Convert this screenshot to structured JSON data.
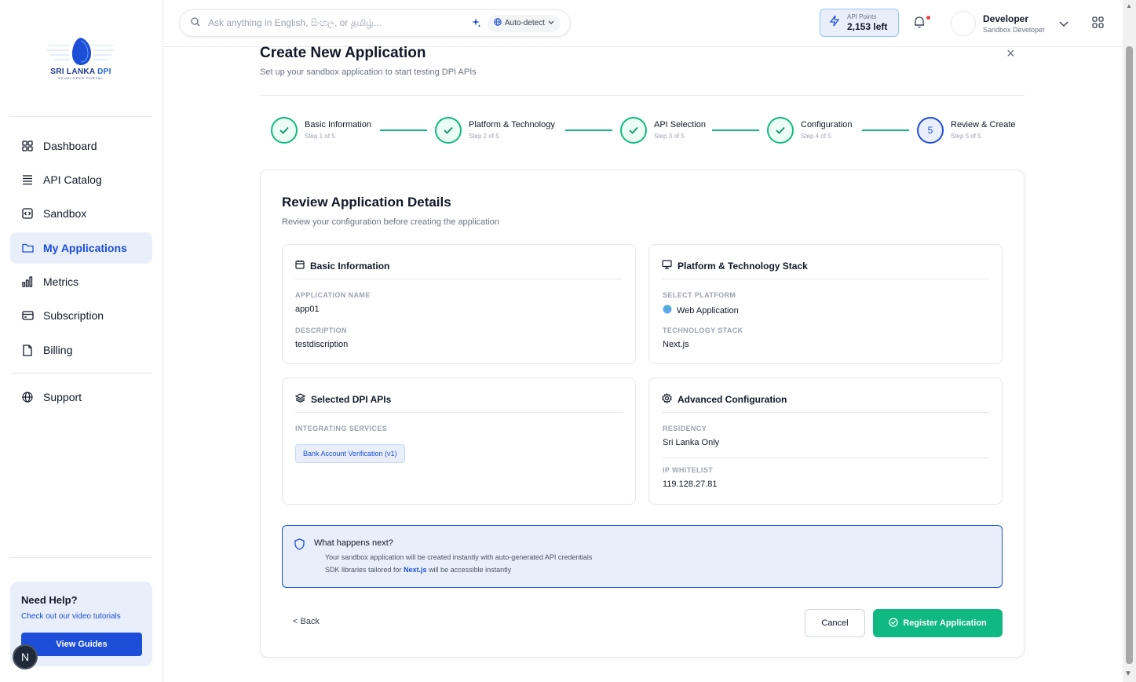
{
  "sidebar": {
    "logo": {
      "text_main": "SRI LANKA ",
      "text_accent": "DPI",
      "text_sub": "DEVELOPER PORTAL"
    },
    "items": [
      {
        "label": "Dashboard",
        "icon": "dashboard-grid-icon"
      },
      {
        "label": "API Catalog",
        "icon": "list-icon"
      },
      {
        "label": "Sandbox",
        "icon": "code-box-icon"
      },
      {
        "label": "My Applications",
        "icon": "folder-icon",
        "active": true
      },
      {
        "label": "Metrics",
        "icon": "bar-chart-icon"
      },
      {
        "label": "Subscription",
        "icon": "credit-card-icon"
      },
      {
        "label": "Billing",
        "icon": "file-icon"
      },
      {
        "label": "Support",
        "icon": "globe-icon"
      }
    ],
    "help": {
      "title": "Need Help?",
      "subtitle": "Check out our video tutorials",
      "button": "View Guides"
    },
    "badge": "N"
  },
  "topbar": {
    "search_placeholder": "Ask anything in English, සිංහල, or தமிழ்...",
    "language": "Auto-detect",
    "points_label": "API Points",
    "points_value": "2,153 left",
    "user_name": "Developer",
    "user_role": "Sandbox Developer"
  },
  "page": {
    "title": "Create New Application",
    "subtitle": "Set up your sandbox application to start testing DPI APIs",
    "close": "×"
  },
  "steps": [
    {
      "title": "Basic Information",
      "sub": "Step 1 of 5",
      "status": "done"
    },
    {
      "title": "Platform & Technology",
      "sub": "Step 2 of 5",
      "status": "done"
    },
    {
      "title": "API Selection",
      "sub": "Step 3 of 5",
      "status": "done"
    },
    {
      "title": "Configuration",
      "sub": "Step 4 of 5",
      "status": "done"
    },
    {
      "title": "Review & Create",
      "sub": "Step 5 of 5",
      "status": "current",
      "number": "5"
    }
  ],
  "review": {
    "title": "Review Application Details",
    "subtitle": "Review your configuration before creating the application",
    "basic": {
      "heading": "Basic Information",
      "name_label": "APPLICATION NAME",
      "name_value": "app01",
      "desc_label": "DESCRIPTION",
      "desc_value": "testdiscription"
    },
    "platform": {
      "heading": "Platform & Technology Stack",
      "platform_label": "SELECT PLATFORM",
      "platform_value": "Web Application",
      "tech_label": "TECHNOLOGY STACK",
      "tech_value": "Next.js"
    },
    "apis": {
      "heading": "Selected DPI APIs",
      "label": "INTEGRATING SERVICES",
      "items": [
        "Bank Account Verification (v1)"
      ]
    },
    "advanced": {
      "heading": "Advanced Configuration",
      "residency_label": "RESIDENCY",
      "residency_value": "Sri Lanka Only",
      "ip_label": "IP WHITELIST",
      "ip_value": "119.128.27.81"
    }
  },
  "info": {
    "title": "What happens next?",
    "line1": "Your sandbox application will be created instantly with auto-generated API credentials",
    "line2_pre": "SDK libraries tailored for ",
    "line2_tech": "Next.js",
    "line2_post": " will be accessible instantly"
  },
  "actions": {
    "back": "< Back",
    "cancel": "Cancel",
    "register": "Register Application"
  },
  "colors": {
    "primary": "#1d4ed8",
    "success": "#10b981",
    "active_bg": "#e8effb"
  }
}
